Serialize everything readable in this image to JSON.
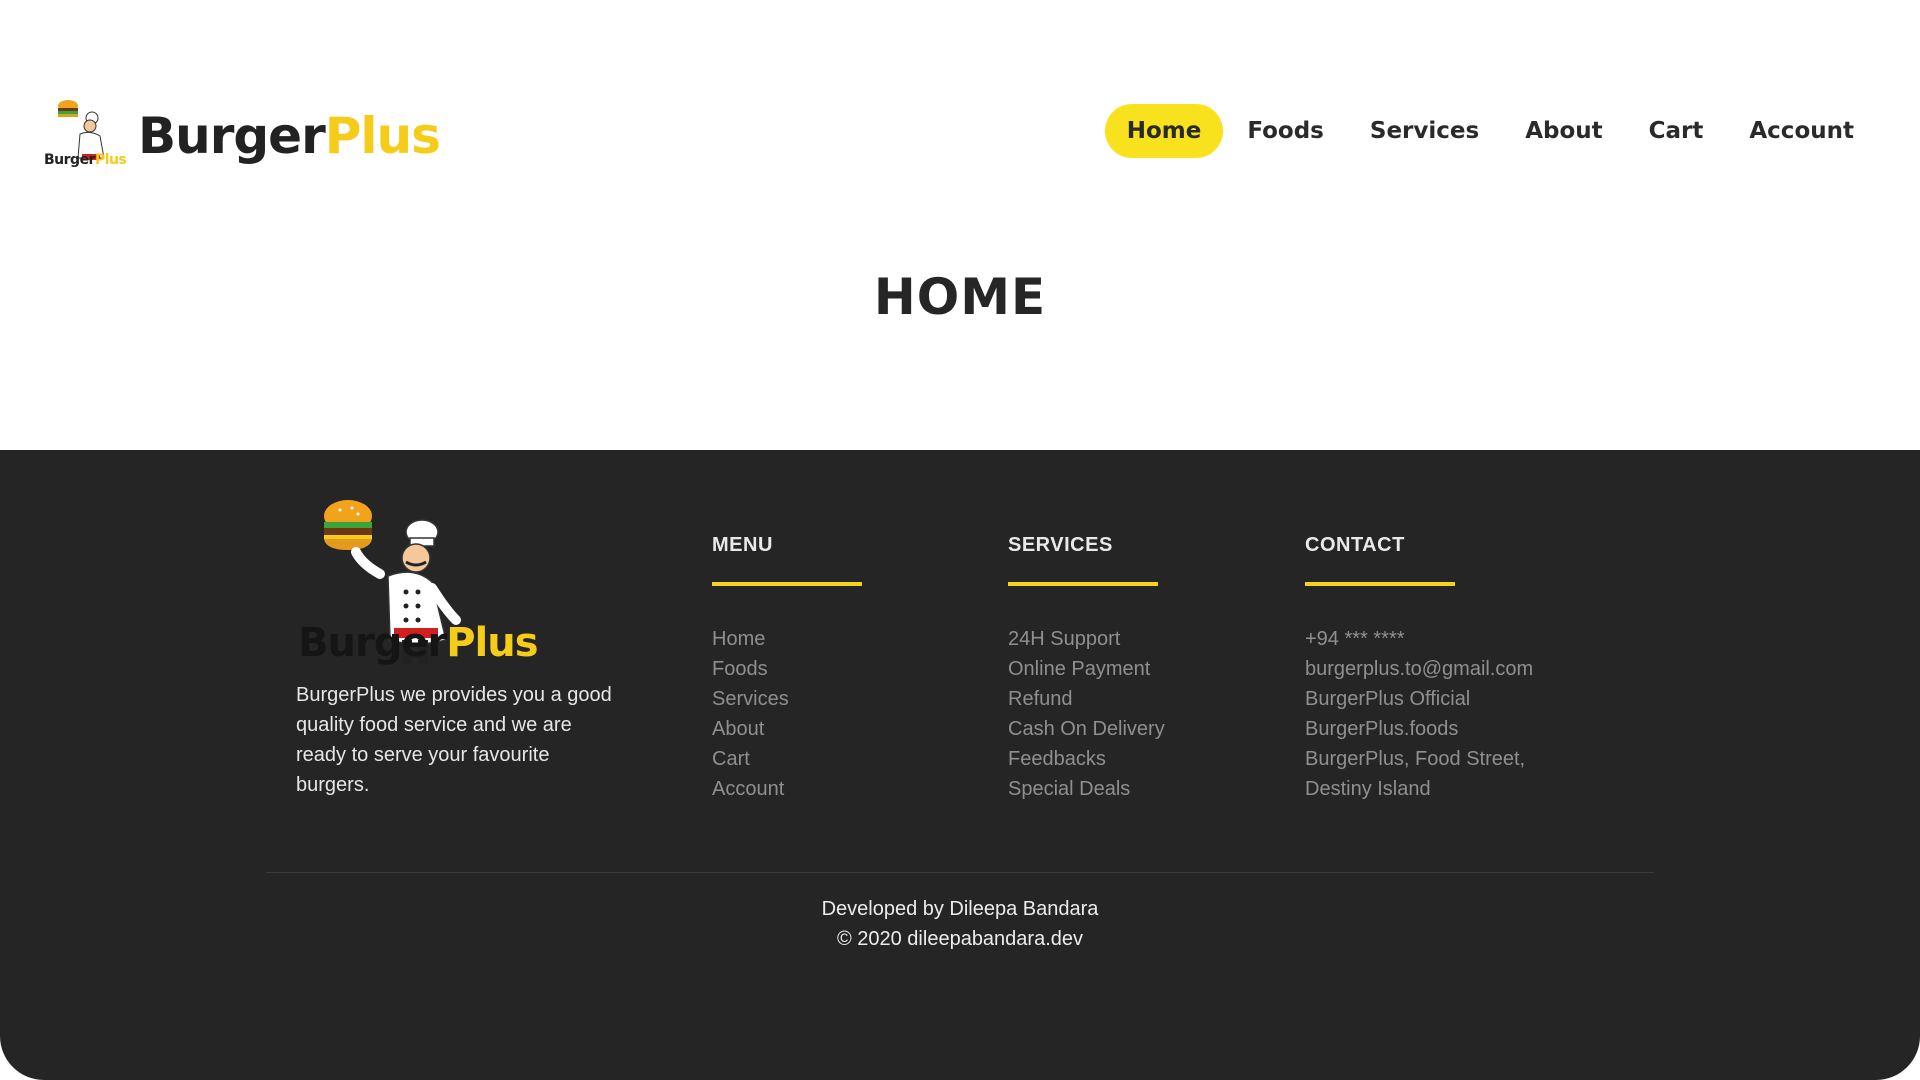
{
  "brand": {
    "name_part1": "Burger",
    "name_part2": "Plus",
    "badge_part1": "Burger",
    "badge_part2": "Plus",
    "accent_color": "#f8e11d",
    "dark_color": "#252525"
  },
  "nav": {
    "items": [
      {
        "label": "Home",
        "active": true
      },
      {
        "label": "Foods",
        "active": false
      },
      {
        "label": "Services",
        "active": false
      },
      {
        "label": "About",
        "active": false
      },
      {
        "label": "Cart",
        "active": false
      },
      {
        "label": "Account",
        "active": false
      }
    ]
  },
  "page": {
    "title": "HOME"
  },
  "footer": {
    "logo_part1": "Burger",
    "logo_part2": "Plus",
    "about": "BurgerPlus we provides you a good quality food service and we are ready to serve your favourite burgers.",
    "menu": {
      "heading": "MENU",
      "links": [
        "Home",
        "Foods",
        "Services",
        "About",
        "Cart",
        "Account"
      ]
    },
    "services": {
      "heading": "SERVICES",
      "links": [
        "24H Support",
        "Online Payment",
        "Refund",
        "Cash On Delivery",
        "Feedbacks",
        "Special Deals"
      ]
    },
    "contact": {
      "heading": "CONTACT",
      "links": [
        "+94 *** ****",
        "burgerplus.to@gmail.com",
        "BurgerPlus Official",
        "BurgerPlus.foods",
        "BurgerPlus, Food Street,",
        "Destiny Island"
      ]
    },
    "credit_line1": "Developed by Dileepa Bandara",
    "credit_line2": "© 2020 dileepabandara.dev"
  }
}
